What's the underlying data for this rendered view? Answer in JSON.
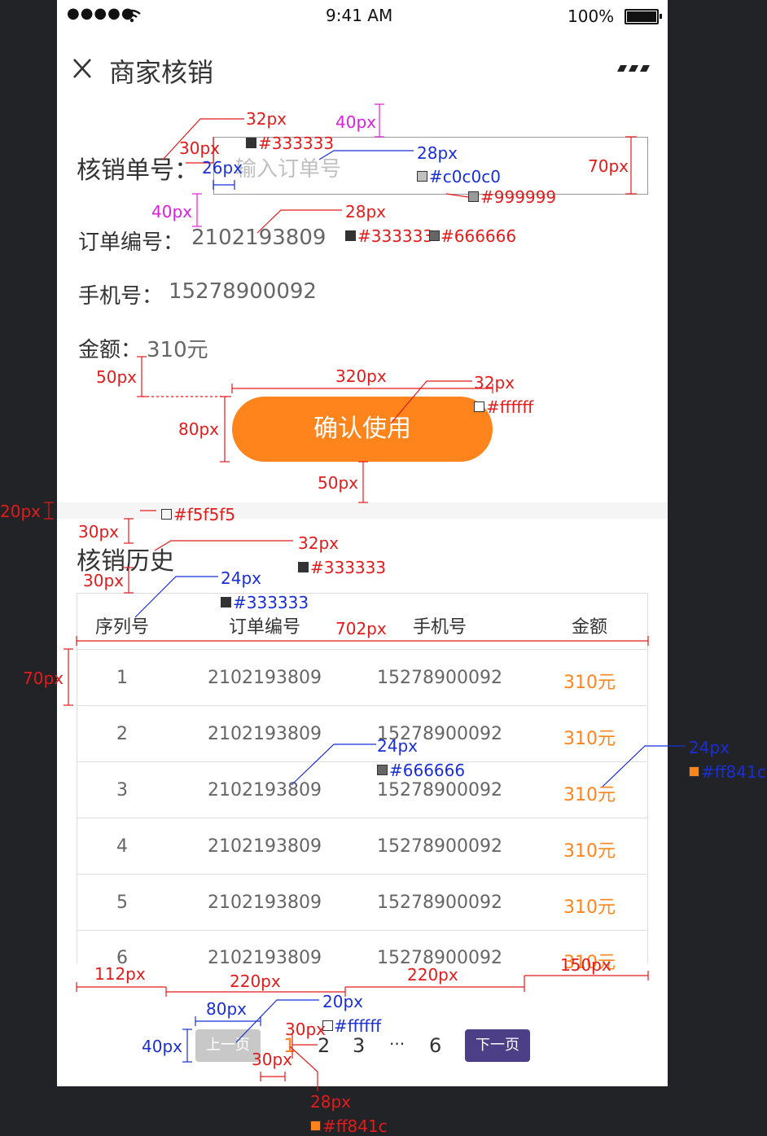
{
  "status_bar": {
    "signal": "●●●●●",
    "time": "9:41 AM",
    "battery": "100%"
  },
  "nav": {
    "title": "商家核销",
    "close_icon": "close-icon",
    "more_icon": "more-icon"
  },
  "form": {
    "verify_label": "核销单号：",
    "verify_placeholder": "输入订单号",
    "order_label": "订单编号：",
    "order_value": "2102193809",
    "phone_label": "手机号：",
    "phone_value": "15278900092",
    "amount_label": "金额：",
    "amount_value": "310元",
    "confirm_button": "确认使用"
  },
  "history": {
    "title": "核销历史",
    "columns": [
      "序列号",
      "订单编号",
      "手机号",
      "金额"
    ],
    "rows": [
      {
        "seq": "1",
        "order": "2102193809",
        "phone": "15278900092",
        "amount": "310元"
      },
      {
        "seq": "2",
        "order": "2102193809",
        "phone": "15278900092",
        "amount": "310元"
      },
      {
        "seq": "3",
        "order": "2102193809",
        "phone": "15278900092",
        "amount": "310元"
      },
      {
        "seq": "4",
        "order": "2102193809",
        "phone": "15278900092",
        "amount": "310元"
      },
      {
        "seq": "5",
        "order": "2102193809",
        "phone": "15278900092",
        "amount": "310元"
      },
      {
        "seq": "6",
        "order": "2102193809",
        "phone": "15278900092",
        "amount": "310元"
      }
    ]
  },
  "pagination": {
    "prev": "上一页",
    "pages": [
      "1",
      "2",
      "3",
      "···",
      "6"
    ],
    "next": "下一页",
    "current": "1"
  },
  "colors": {
    "accent": "#ff841c",
    "text_main": "#333333",
    "text_sub": "#666666",
    "placeholder": "#c0c0c0",
    "border": "#999999",
    "divider": "#f5f5f5",
    "next_button": "#4c3f87",
    "prev_button": "#c8c8c8"
  },
  "annotations": {
    "a1": "32px",
    "a2": "#333333",
    "a3": "40px",
    "a4": "30px",
    "a5": "26px",
    "a6": "28px",
    "a7": "#c0c0c0",
    "a8": "70px",
    "a9": "#999999",
    "a10": "40px",
    "a11": "28px",
    "a12": "#333333",
    "a13": "#666666",
    "a14": "50px",
    "a15": "320px",
    "a16": "32px",
    "a17": "#ffffff",
    "a18": "80px",
    "a19": "50px",
    "a20": "20px",
    "a21": "#f5f5f5",
    "a22": "30px",
    "a23": "32px",
    "a24": "#333333",
    "a25": "30px",
    "a26": "24px",
    "a27": "#333333",
    "a28": "702px",
    "a29": "70px",
    "a30": "24px",
    "a31": "#666666",
    "a32": "24px",
    "a33": "#ff841c",
    "a34": "112px",
    "a35": "220px",
    "a36": "220px",
    "a37": "150px",
    "a38": "80px",
    "a39": "20px",
    "a40": "#ffffff",
    "a41": "40px",
    "a42": "30px",
    "a43": "30px",
    "a44": "28px",
    "a45": "#ff841c"
  }
}
